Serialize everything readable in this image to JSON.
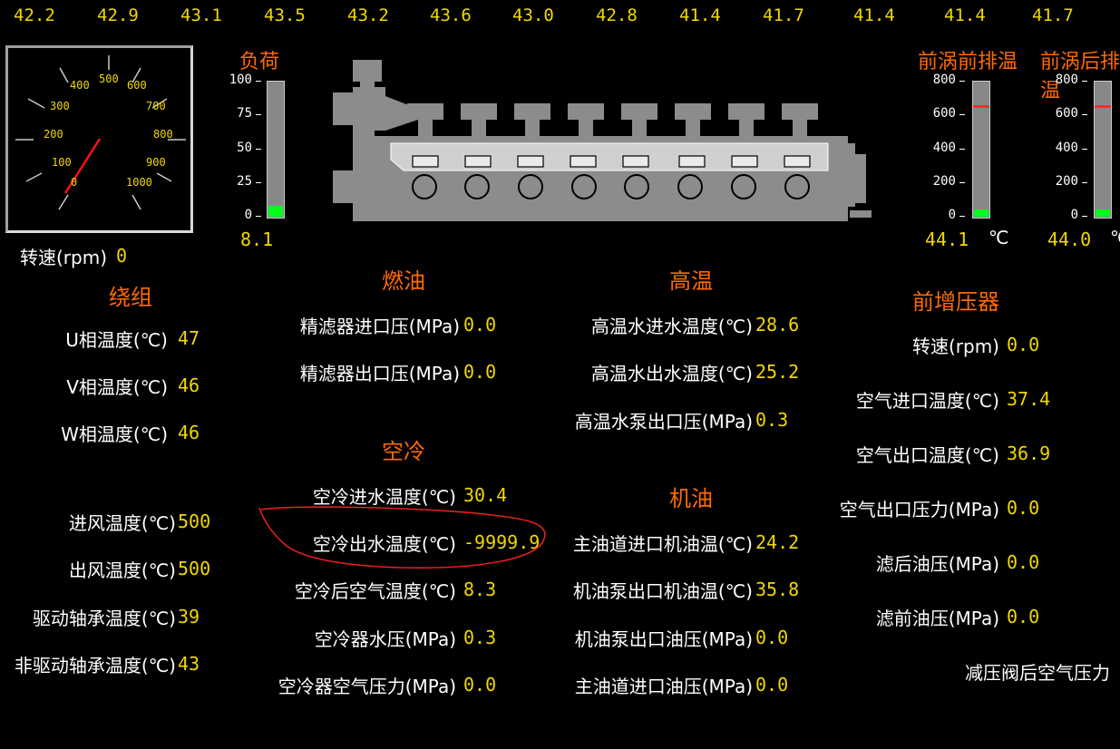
{
  "top_values": [
    "42.2",
    "42.9",
    "43.1",
    "43.5",
    "43.2",
    "43.6",
    "43.0",
    "42.8",
    "41.4",
    "41.7",
    "41.4",
    "41.4",
    "41.7"
  ],
  "speed_gauge": {
    "scale": [
      "0",
      "100",
      "200",
      "300",
      "400",
      "500",
      "600",
      "700",
      "800",
      "900",
      "1000"
    ],
    "label": "转速(rpm)",
    "value": "0"
  },
  "load": {
    "title": "负荷",
    "ticks": [
      "100",
      "75",
      "50",
      "25",
      "0"
    ],
    "value": "8.1",
    "fill_fraction": 0.081
  },
  "exhaust_pre": {
    "title": "前涡前排温",
    "ticks": [
      "800",
      "600",
      "400",
      "200",
      "0"
    ],
    "value": "44.1",
    "unit": "℃",
    "fill_fraction": 0.055,
    "alarm_fraction": 0.81
  },
  "exhaust_post": {
    "title": "前涡后排温",
    "ticks": [
      "800",
      "600",
      "400",
      "200",
      "0"
    ],
    "value": "44.0",
    "unit": "℃",
    "fill_fraction": 0.055,
    "alarm_fraction": 0.81
  },
  "winding": {
    "title": "绕组",
    "items": [
      {
        "label": "U相温度(℃)",
        "value": "47"
      },
      {
        "label": "V相温度(℃)",
        "value": "46"
      },
      {
        "label": "W相温度(℃)",
        "value": "46"
      }
    ]
  },
  "air_bearing": {
    "items": [
      {
        "label": "进风温度(℃)",
        "value": "500"
      },
      {
        "label": "出风温度(℃)",
        "value": "500"
      },
      {
        "label": "驱动轴承温度(℃)",
        "value": "39"
      },
      {
        "label": "非驱动轴承温度(℃)",
        "value": "43"
      }
    ]
  },
  "fuel": {
    "title": "燃油",
    "items": [
      {
        "label": "精滤器进口压(MPa)",
        "value": "0.0"
      },
      {
        "label": "精滤器出口压(MPa)",
        "value": "0.0"
      }
    ]
  },
  "aircool": {
    "title": "空冷",
    "items": [
      {
        "label": "空冷进水温度(℃)",
        "value": "30.4"
      },
      {
        "label": "空冷出水温度(℃)",
        "value": "-9999.9"
      },
      {
        "label": "空冷后空气温度(℃)",
        "value": "8.3"
      },
      {
        "label": "空冷器水压(MPa)",
        "value": "0.3"
      },
      {
        "label": "空冷器空气压力(MPa)",
        "value": "0.0"
      }
    ]
  },
  "hightemp": {
    "title": "高温",
    "items": [
      {
        "label": "高温水进水温度(℃)",
        "value": "28.6"
      },
      {
        "label": "高温水出水温度(℃)",
        "value": "25.2"
      },
      {
        "label": "高温水泵出口压(MPa)",
        "value": "0.3"
      }
    ]
  },
  "oil": {
    "title": "机油",
    "items": [
      {
        "label": "主油道进口机油温(℃)",
        "value": "24.2"
      },
      {
        "label": "机油泵出口机油温(℃)",
        "value": "35.8"
      },
      {
        "label": "机油泵出口油压(MPa)",
        "value": "0.0"
      },
      {
        "label": "主油道进口油压(MPa)",
        "value": "0.0"
      }
    ]
  },
  "turbo": {
    "title": "前增压器",
    "items": [
      {
        "label": "转速(rpm)",
        "value": "0.0"
      },
      {
        "label": "空气进口温度(℃)",
        "value": "37.4"
      },
      {
        "label": "空气出口温度(℃)",
        "value": "36.9"
      },
      {
        "label": "空气出口压力(MPa)",
        "value": "0.0"
      },
      {
        "label": "滤后油压(MPa)",
        "value": "0.0"
      },
      {
        "label": "滤前油压(MPa)",
        "value": "0.0"
      }
    ],
    "extra_label": "减压阀后空气压力"
  },
  "colors": {
    "label": "#ffffff",
    "value": "#f0d800",
    "section": "#ff6a00",
    "bar_fill": "#00ff1a",
    "alarm": "#ff2a2a",
    "annotation": "#e02020"
  }
}
